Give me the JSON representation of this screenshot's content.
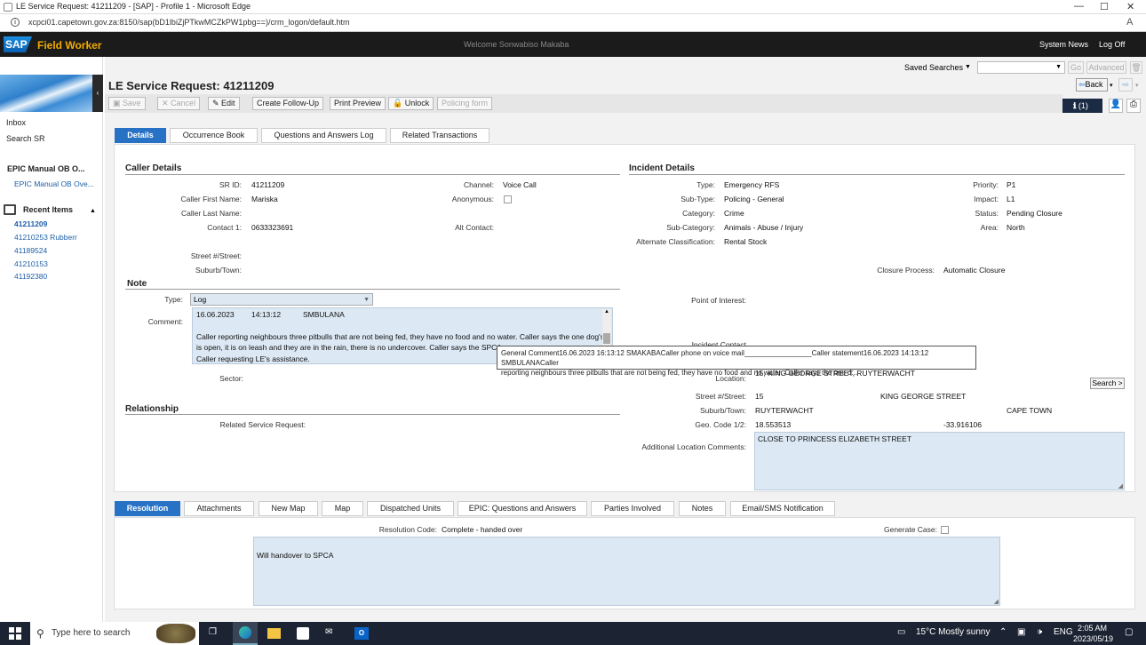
{
  "browser": {
    "title": "LE Service Request: 41211209 - [SAP] - Profile 1 - Microsoft Edge",
    "url": "xcpci01.capetown.gov.za:8150/sap(bD1lbiZjPTkwMCZkPW1pbg==)/crm_logon/default.htm"
  },
  "sap": {
    "logo": "SAP",
    "app_name": "Field Worker",
    "welcome": "Welcome Sonwabiso Makaba",
    "system_news": "System News",
    "log_off": "Log Off"
  },
  "left": {
    "inbox": "Inbox",
    "search_sr": "Search SR",
    "epic_title": "EPIC Manual OB O...",
    "epic_link": "EPIC Manual OB Ove...",
    "recent_title": "Recent Items",
    "recent": [
      "41211209",
      "41210253 Rubberr",
      "41189524",
      "41210153",
      "41192380"
    ]
  },
  "top": {
    "saved_searches": "Saved Searches",
    "go": "Go",
    "advanced": "Advanced",
    "back": "Back",
    "notif": "(1)"
  },
  "page": {
    "title": "LE Service Request: 41211209"
  },
  "toolbar": {
    "save": "Save",
    "cancel": "Cancel",
    "edit": "Edit",
    "follow": "Create Follow-Up",
    "print": "Print Preview",
    "unlock": "Unlock",
    "policing": "Policing form"
  },
  "tabs": [
    "Details",
    "Occurrence Book",
    "Questions and Answers Log",
    "Related Transactions"
  ],
  "caller": {
    "title": "Caller Details",
    "sr_id_l": "SR ID:",
    "sr_id": "41211209",
    "first_l": "Caller First Name:",
    "first": "Mariska",
    "last_l": "Caller Last Name:",
    "contact_l": "Contact 1:",
    "contact": "0633323691",
    "street_l": "Street #/Street:",
    "suburb_l": "Suburb/Town:",
    "channel_l": "Channel:",
    "channel": "Voice Call",
    "anon_l": "Anonymous:",
    "alt_l": "Alt Contact:"
  },
  "note": {
    "title": "Note",
    "type_l": "Type:",
    "type": "Log",
    "comment_l": "Comment:",
    "date": "16.06.2023",
    "time": "14:13:12",
    "user": "SMBULANA",
    "line1": "Caller reporting neighbours three pitbulls that are not being fed, they have no food and no water. Caller says the one dog's neck",
    "line2": "is open, it is on leash and they are in the rain, there is no undercover. Caller says the SPCA wa",
    "line3": "Caller requesting LE's assistance.",
    "sector_l": "Sector:"
  },
  "tooltip": {
    "line1": "General Comment16.06.2023 16:13:12 SMAKABACaller phone on voice mail_________________Caller statement16.06.2023 14:13:12 SMBULANACaller",
    "line2": "reporting neighbours three pitbulls that are not being fed, they have no food and no water. Caller says the one d..."
  },
  "relationship": {
    "title": "Relationship",
    "rsr_l": "Related Service Request:"
  },
  "incident": {
    "title": "Incident Details",
    "type_l": "Type:",
    "type": "Emergency RFS",
    "subtype_l": "Sub-Type:",
    "subtype": "Policing - General",
    "cat_l": "Category:",
    "cat": "Crime",
    "subcat_l": "Sub-Category:",
    "subcat": "Animals - Abuse / Injury",
    "altclass_l": "Alternate Classification:",
    "altclass": "Rental Stock",
    "prio_l": "Priority:",
    "prio": "P1",
    "impact_l": "Impact:",
    "impact": "L1",
    "status_l": "Status:",
    "status": "Pending Closure",
    "area_l": "Area:",
    "area": "North",
    "closure_l": "Closure Process:",
    "closure": "Automatic Closure",
    "poi_l": "Point of Interest:",
    "ic_l": "Incident Contact",
    "loc_l": "Location:",
    "loc": "15, KING GEORGE STREET, RUYTERWACHT",
    "street_l": "Street #/Street:",
    "street_no": "15",
    "street": "KING GEORGE STREET",
    "suburb_l": "Suburb/Town:",
    "suburb": "RUYTERWACHT",
    "town": "CAPE TOWN",
    "geo_l": "Geo. Code 1/2:",
    "geo1": "18.553513",
    "geo2": "-33.916106",
    "addl_l": "Additional Location Comments:",
    "addl": "CLOSE TO PRINCESS ELIZABETH STREET",
    "search": "Search >"
  },
  "btabs": [
    "Resolution",
    "Attachments",
    "New Map",
    "Map",
    "Dispatched Units",
    "EPIC: Questions and Answers",
    "Parties Involved",
    "Notes",
    "Email/SMS Notification"
  ],
  "resolution": {
    "code_l": "Resolution Code:",
    "code": "Complete - handed over",
    "gen_l": "Generate Case:",
    "text": "Will handover to SPCA"
  },
  "taskbar": {
    "search": "Type here to search",
    "weather": "15°C  Mostly sunny",
    "lang": "ENG",
    "time": "2:05 AM",
    "date": "2023/05/19"
  }
}
